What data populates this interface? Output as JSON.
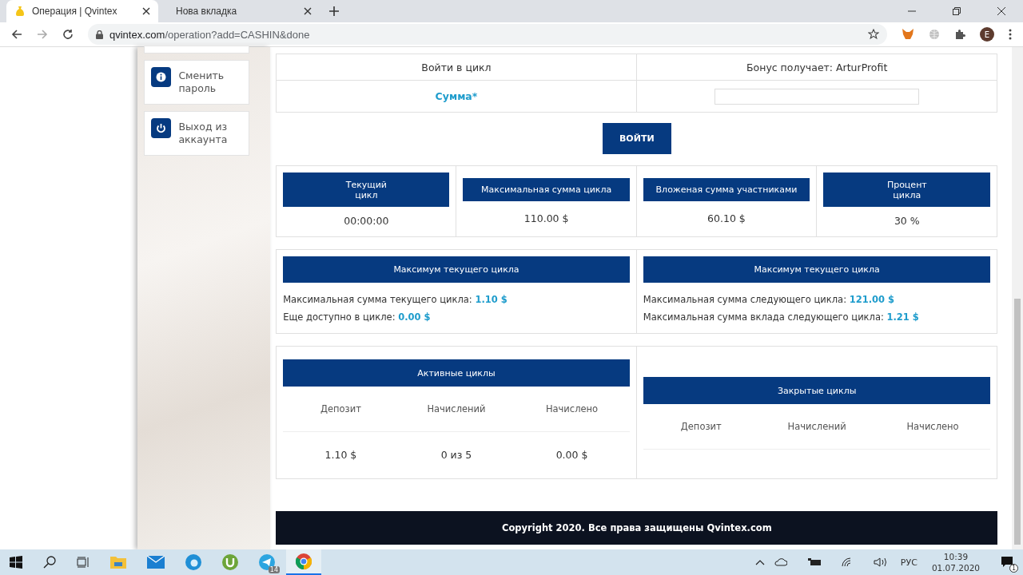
{
  "browser": {
    "tabs": [
      {
        "title": "Операция | Qvintex",
        "selected": true
      },
      {
        "title": "Нова вкладка",
        "selected": false
      }
    ],
    "url": {
      "host": "qvintex.com",
      "path": "/operation?add=CASHIN&done"
    },
    "profile": "E"
  },
  "sidebar": {
    "items": [
      {
        "label": "Сменить пароль",
        "kind": "info"
      },
      {
        "label": "Выход из аккаунта",
        "kind": "power"
      }
    ]
  },
  "entry": {
    "title": "Войти в цикл",
    "bonus": "Бонус получает: ArturProfit",
    "amount_label": "Сумма*",
    "submit": "ВОЙТИ"
  },
  "stats": [
    {
      "title": "Текущий\nцикл",
      "value": "00:00:00"
    },
    {
      "title": "Максимальная сумма цикла",
      "value": "110.00 $"
    },
    {
      "title": "Вложеная сумма участниками",
      "value": "60.10 $"
    },
    {
      "title": "Процент\nцикла",
      "value": "30 %"
    }
  ],
  "limits": [
    {
      "title": "Максимум текущего цикла",
      "lines": [
        {
          "label": "Максимальная сумма текущего цикла:",
          "value": "1.10 $"
        },
        {
          "label": "Еще доступно в цикле:",
          "value": "0.00 $"
        }
      ]
    },
    {
      "title": "Максимум текущего цикла",
      "lines": [
        {
          "label": "Максимальная сумма следующего цикла:",
          "value": "121.00 $"
        },
        {
          "label": "Максимальная сумма вклада следующего цикла:",
          "value": "1.21 $"
        }
      ]
    }
  ],
  "cycles": [
    {
      "title": "Активные циклы",
      "columns": [
        "Депозит",
        "Начислений",
        "Начислено"
      ],
      "rows": [
        [
          "1.10 $",
          "0 из 5",
          "0.00 $"
        ]
      ]
    },
    {
      "title": "Закрытые циклы",
      "columns": [
        "Депозит",
        "Начислений",
        "Начислено"
      ]
    }
  ],
  "footer": "Copyright 2020. Все права защищены Qvintex.com",
  "taskbar": {
    "telegram_badge": "14",
    "language": "РУС",
    "time": "10:39",
    "date": "01.07.2020",
    "notifications": "1"
  }
}
